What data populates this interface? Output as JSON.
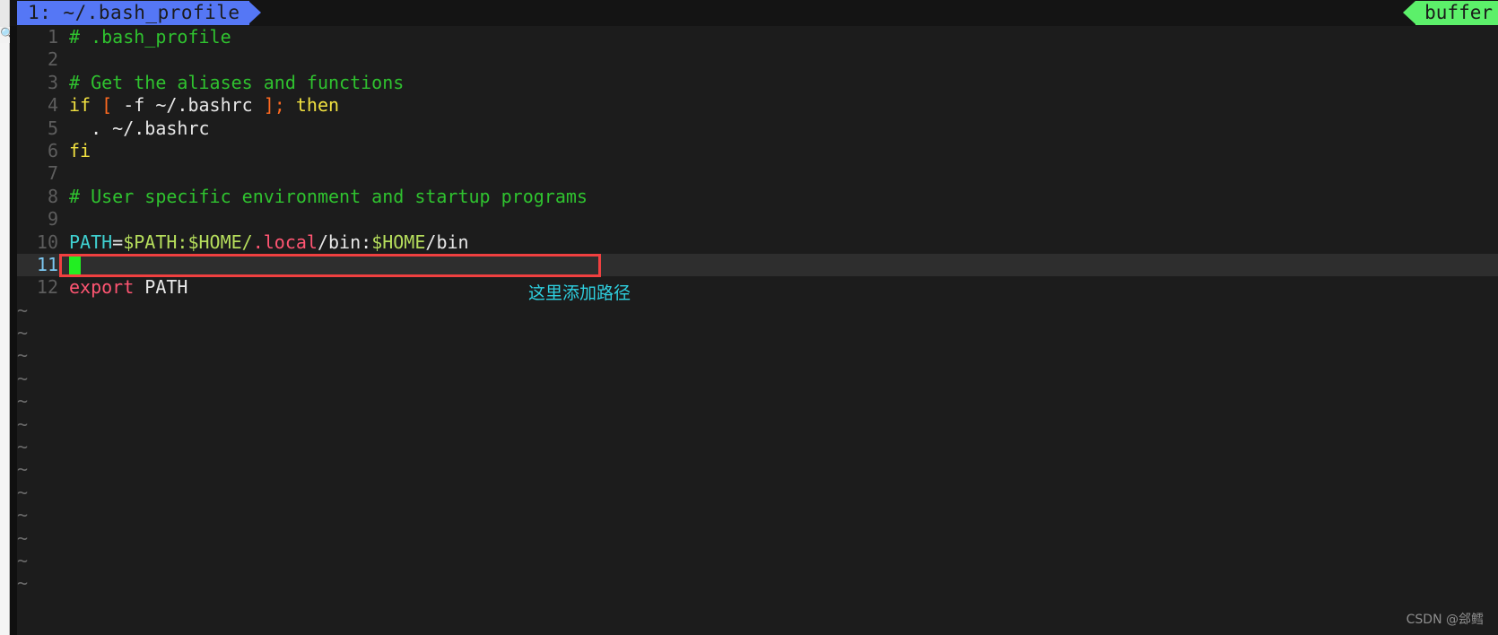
{
  "window": {
    "chrome_icon": "search-icon"
  },
  "tabline": {
    "active_tab": "1: ~/.bash_profile",
    "right_label": "buffer"
  },
  "editor": {
    "filename": "~/.bash_profile",
    "current_line": 11,
    "lines": [
      {
        "num": "1",
        "tokens": [
          {
            "t": "# .bash_profile",
            "c": "t-comment"
          }
        ]
      },
      {
        "num": "2",
        "tokens": []
      },
      {
        "num": "3",
        "tokens": [
          {
            "t": "# Get the aliases and functions",
            "c": "t-comment"
          }
        ]
      },
      {
        "num": "4",
        "tokens": [
          {
            "t": "if ",
            "c": "t-kw"
          },
          {
            "t": "[",
            "c": "t-bracket"
          },
          {
            "t": " -f ~/.bashrc ",
            "c": "t-plain"
          },
          {
            "t": "]",
            "c": "t-bracket"
          },
          {
            "t": ";",
            "c": "t-bracket"
          },
          {
            "t": " ",
            "c": "t-plain"
          },
          {
            "t": "then",
            "c": "t-kw"
          }
        ]
      },
      {
        "num": "5",
        "tokens": [
          {
            "t": "  . ~/.bashrc",
            "c": "t-plain"
          }
        ]
      },
      {
        "num": "6",
        "tokens": [
          {
            "t": "fi",
            "c": "t-kw"
          }
        ]
      },
      {
        "num": "7",
        "tokens": []
      },
      {
        "num": "8",
        "tokens": [
          {
            "t": "# User specific environment and startup programs",
            "c": "t-comment"
          }
        ]
      },
      {
        "num": "9",
        "tokens": []
      },
      {
        "num": "10",
        "tokens": [
          {
            "t": "PATH",
            "c": "t-var"
          },
          {
            "t": "=",
            "c": "t-plain"
          },
          {
            "t": "$PATH:$HOME/",
            "c": "t-green"
          },
          {
            "t": ".local",
            "c": "t-pink"
          },
          {
            "t": "/bin:",
            "c": "t-plain"
          },
          {
            "t": "$HOME",
            "c": "t-green"
          },
          {
            "t": "/bin",
            "c": "t-plain"
          }
        ]
      },
      {
        "num": "11",
        "tokens": [],
        "current": true,
        "cursor": true
      },
      {
        "num": "12",
        "tokens": [
          {
            "t": "export",
            "c": "t-pink"
          },
          {
            "t": " PATH",
            "c": "t-plain"
          }
        ]
      }
    ],
    "filler_count": 13,
    "filler_glyph": "~"
  },
  "annotation": {
    "rect_label": "red-highlight-box",
    "note_text": "这里添加路径"
  },
  "watermark": {
    "text": "CSDN @郐鳕"
  },
  "colors": {
    "tab_active_bg": "#5577f5",
    "tab_right_bg": "#5cf06a",
    "cursor": "#22ee22",
    "annotation_rect": "#f04040",
    "annotation_text": "#2ed0e0",
    "comment": "#2fc22f",
    "keyword": "#f0e040",
    "variable": "#3fd0d0",
    "string_green": "#b6de5c",
    "pink": "#ff5572",
    "background": "#1c1c1c",
    "current_line_bg": "#2e2e2e"
  }
}
